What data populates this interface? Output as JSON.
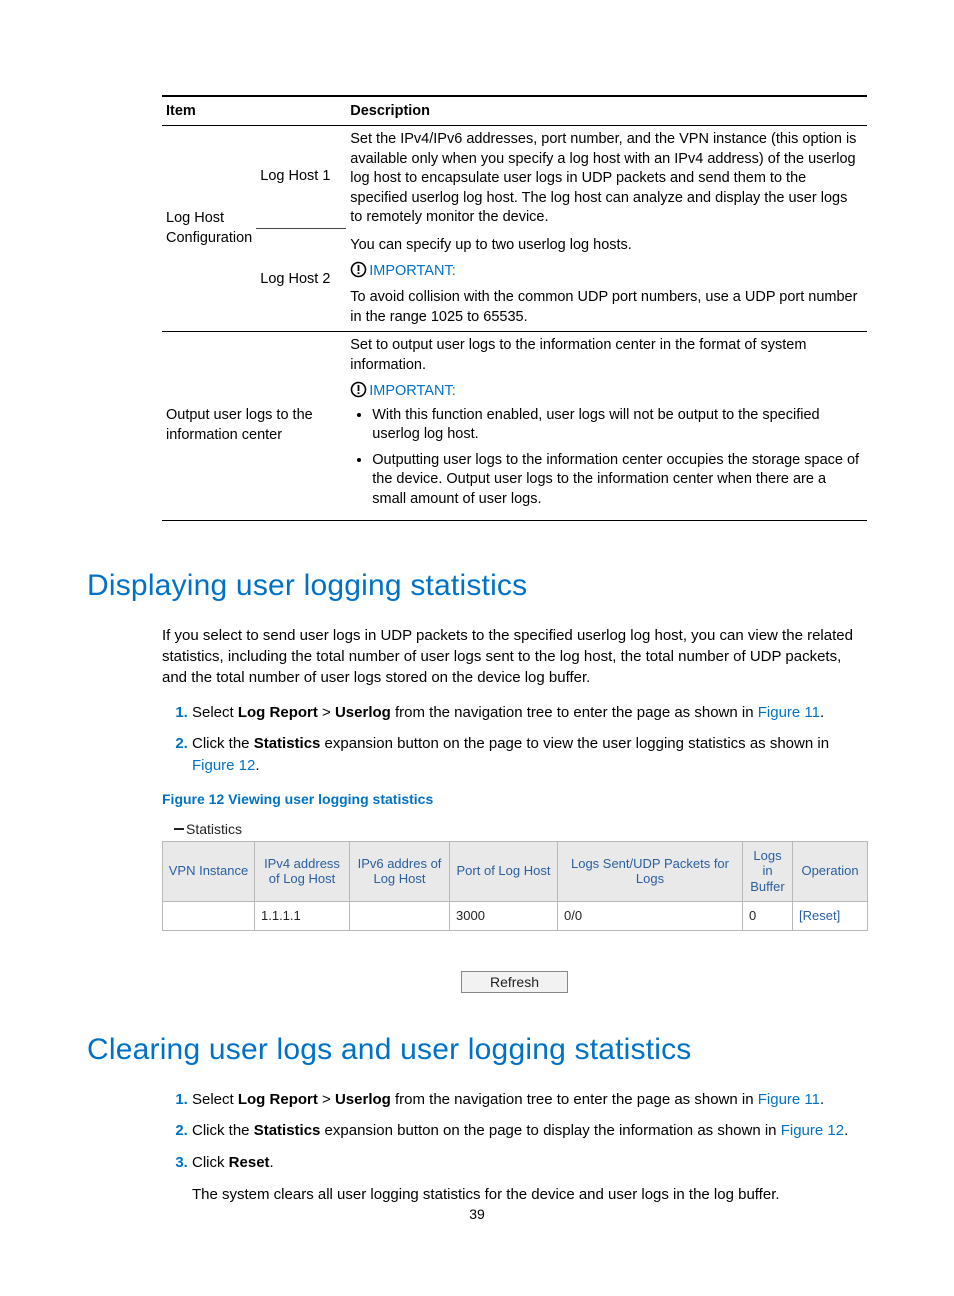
{
  "config_table": {
    "headers": {
      "item": "Item",
      "description": "Description"
    },
    "rows": {
      "log_host_config": {
        "label": "Log Host Configuration",
        "sub": {
          "host1": "Log Host 1",
          "host2": "Log Host 2"
        },
        "desc_p1": "Set the IPv4/IPv6 addresses, port number, and the VPN instance (this option is available only when you specify a log host with an IPv4 address) of the userlog log host to encapsulate user logs in UDP packets and send them to the specified userlog log host. The log host can analyze and display the user logs to remotely monitor the device.",
        "desc_p2": "You can specify up to two userlog log hosts.",
        "important_label": "IMPORTANT:",
        "desc_p3": "To avoid collision with the common UDP port numbers, use a UDP port number in the range 1025 to 65535."
      },
      "output_center": {
        "label": "Output user logs to the information center",
        "desc_p1": "Set to output user logs to the information center in the format of system information.",
        "important_label": "IMPORTANT:",
        "bullets": [
          "With this function enabled, user logs will not be output to the specified userlog log host.",
          "Outputting user logs to the information center occupies the storage space of the device. Output user logs to the information center when there are a small amount of user logs."
        ]
      }
    }
  },
  "section1": {
    "heading": "Displaying user logging statistics",
    "intro": "If you select to send user logs in UDP packets to the specified userlog log host, you can view the related statistics, including the total number of user logs sent to the log host, the total number of UDP packets, and the total number of user logs stored on the device log buffer.",
    "steps": {
      "s1a": "Select ",
      "s1_bold1": "Log Report",
      "s1_gt": " > ",
      "s1_bold2": "Userlog",
      "s1b": " from the navigation tree to enter the page as shown in ",
      "s1_link": "Figure 11",
      "s1_end": ".",
      "s2a": "Click the ",
      "s2_bold": "Statistics",
      "s2b": " expansion button on the page to view the user logging statistics as shown in ",
      "s2_link": "Figure 12",
      "s2_end": "."
    },
    "figure_caption": "Figure 12 Viewing user logging statistics",
    "stats_label": "Statistics",
    "stats_table": {
      "headers": {
        "vpn": "VPN Instance",
        "ipv4": "IPv4 address of Log Host",
        "ipv6": "IPv6 addres of Log Host",
        "port": "Port of Log Host",
        "sent": "Logs Sent/UDP Packets for Logs",
        "buffer": "Logs in Buffer",
        "op": "Operation"
      },
      "row": {
        "vpn": "",
        "ipv4": "1.1.1.1",
        "ipv6": "",
        "port": "3000",
        "sent": "0/0",
        "buffer": "0",
        "op": "[Reset]"
      }
    },
    "refresh_label": "Refresh"
  },
  "section2": {
    "heading": "Clearing user logs and user logging statistics",
    "steps": {
      "s1a": "Select ",
      "s1_bold1": "Log Report",
      "s1_gt": " > ",
      "s1_bold2": "Userlog",
      "s1b": " from the navigation tree to enter the page as shown in ",
      "s1_link": "Figure 11",
      "s1_end": ".",
      "s2a": "Click the ",
      "s2_bold": "Statistics",
      "s2b": " expansion button on the page to display the information as shown in ",
      "s2_link": "Figure 12",
      "s2_end": ".",
      "s3a": "Click ",
      "s3_bold": "Reset",
      "s3_end": ".",
      "s3_para": "The system clears all user logging statistics for the device and user logs in the log buffer."
    }
  },
  "page_number": "39"
}
